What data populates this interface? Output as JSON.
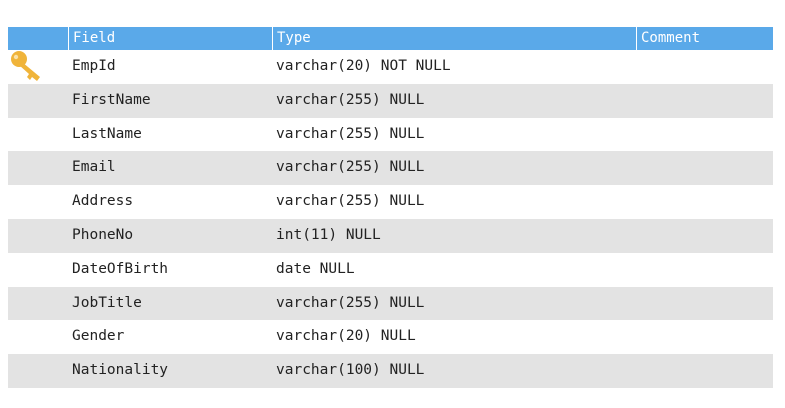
{
  "table": {
    "headers": [
      "",
      "Field",
      "Type",
      "Comment"
    ],
    "rows": [
      {
        "field": "EmpId",
        "type": "varchar(20) NOT NULL",
        "comment": "",
        "primary_key": true
      },
      {
        "field": "FirstName",
        "type": "varchar(255) NULL",
        "comment": "",
        "primary_key": false
      },
      {
        "field": "LastName",
        "type": "varchar(255) NULL",
        "comment": "",
        "primary_key": false
      },
      {
        "field": "Email",
        "type": "varchar(255) NULL",
        "comment": "",
        "primary_key": false
      },
      {
        "field": "Address",
        "type": "varchar(255) NULL",
        "comment": "",
        "primary_key": false
      },
      {
        "field": "PhoneNo",
        "type": "int(11) NULL",
        "comment": "",
        "primary_key": false
      },
      {
        "field": "DateOfBirth",
        "type": "date NULL",
        "comment": "",
        "primary_key": false
      },
      {
        "field": "JobTitle",
        "type": "varchar(255) NULL",
        "comment": "",
        "primary_key": false
      },
      {
        "field": "Gender",
        "type": "varchar(20) NULL",
        "comment": "",
        "primary_key": false
      },
      {
        "field": "Nationality",
        "type": "varchar(100) NULL",
        "comment": "",
        "primary_key": false
      }
    ]
  },
  "icons": {
    "primary_key": "key-icon"
  },
  "colors": {
    "header_bg": "#5aa9e9",
    "header_text": "#ffffff",
    "alt_row_bg": "#e3e3e3",
    "key_icon": "#f0b43a"
  }
}
